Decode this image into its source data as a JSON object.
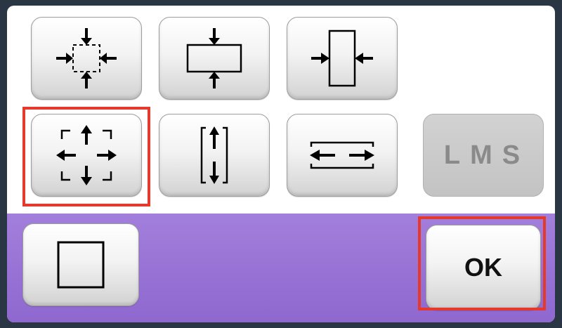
{
  "dialog": {
    "buttons": [
      {
        "id": "expand-all-arrows-in",
        "icon": "shrink-all-sides-icon"
      },
      {
        "id": "vertical-arrows-in",
        "icon": "shrink-vertical-icon"
      },
      {
        "id": "horizontal-arrows-in",
        "icon": "shrink-horizontal-icon"
      },
      {
        "id": "expand-all-arrows-out",
        "icon": "expand-all-sides-icon",
        "highlighted": true
      },
      {
        "id": "vertical-arrows-out",
        "icon": "expand-vertical-icon"
      },
      {
        "id": "horizontal-arrows-out",
        "icon": "expand-horizontal-icon"
      },
      {
        "id": "size-lms",
        "icon": "size-lms",
        "disabled": true
      },
      {
        "id": "square-frame",
        "icon": "square-icon"
      }
    ],
    "lms": {
      "l": "L",
      "m": "M",
      "s": "S"
    },
    "ok_label": "OK",
    "colors": {
      "highlight": "#e53a2b",
      "background_band": "#9a75d6",
      "disabled": "#c8c8c8"
    }
  }
}
